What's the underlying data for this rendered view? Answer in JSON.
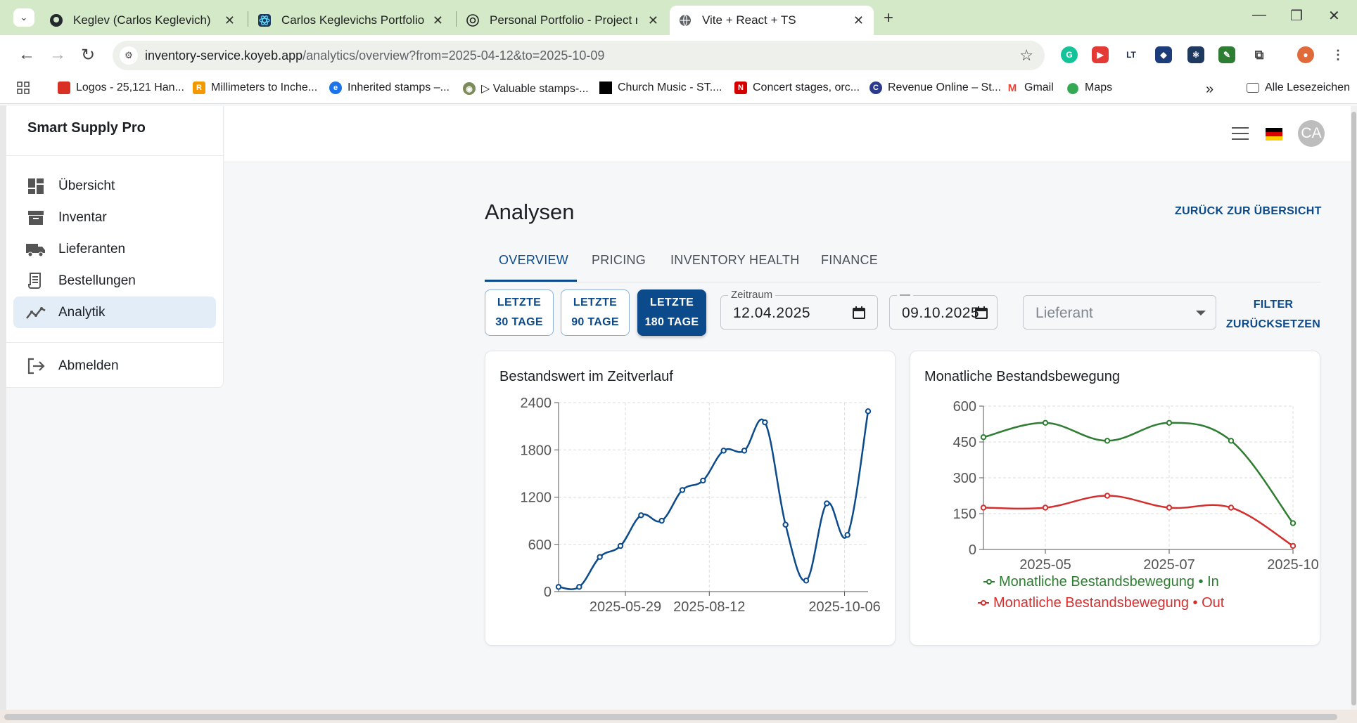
{
  "browser": {
    "tabs": [
      {
        "title": "Keglev (Carlos Keglevich)",
        "icon": "github-icon"
      },
      {
        "title": "Carlos Keglevichs Portfolio",
        "icon": "react-icon"
      },
      {
        "title": "Personal Portfolio - Project revie",
        "icon": "openai-icon"
      },
      {
        "title": "Vite + React + TS",
        "icon": "globe-icon"
      }
    ],
    "url_host": "inventory-service.koyeb.app",
    "url_path": "/analytics/overview?from=2025-04-12&to=2025-10-09",
    "bookmarks": [
      {
        "label": "Logos - 25,121 Han...",
        "color": "#d93025"
      },
      {
        "label": "Millimeters to Inche...",
        "color": "#f29900"
      },
      {
        "label": "Inherited stamps –...",
        "color": "#1a73e8"
      },
      {
        "label": "▷ Valuable stamps-...",
        "color": "#7b8b5a"
      },
      {
        "label": "Church Music - ST....",
        "color": "#000000"
      },
      {
        "label": "Concert stages, orc...",
        "color": "#d50000"
      },
      {
        "label": "Revenue Online – St...",
        "color": "#2b3a8c"
      },
      {
        "label": "Gmail",
        "color": "#ea4335"
      },
      {
        "label": "Maps",
        "color": "#34a853"
      }
    ],
    "all_bookmarks": "Alle Lesezeichen"
  },
  "sidebar": {
    "brand": "Smart Supply Pro",
    "items": [
      {
        "label": "Übersicht",
        "icon": "dashboard-icon"
      },
      {
        "label": "Inventar",
        "icon": "archive-icon"
      },
      {
        "label": "Lieferanten",
        "icon": "truck-icon"
      },
      {
        "label": "Bestellungen",
        "icon": "receipt-icon"
      },
      {
        "label": "Analytik",
        "icon": "analytics-icon"
      }
    ],
    "logout": "Abmelden"
  },
  "header": {
    "avatar_initials": "CA"
  },
  "page": {
    "title": "Analysen",
    "back_link": "ZURÜCK ZUR ÜBERSICHT",
    "tabs": [
      "OVERVIEW",
      "PRICING",
      "INVENTORY HEALTH",
      "FINANCE"
    ],
    "range_buttons": [
      {
        "line1": "LETZTE",
        "line2": "30 TAGE"
      },
      {
        "line1": "LETZTE",
        "line2": "90 TAGE"
      },
      {
        "line1": "LETZTE",
        "line2": "180 TAGE"
      }
    ],
    "date_from_label": "Zeitraum",
    "date_from": "12.04.2025",
    "date_to_label": "—",
    "date_to": "09.10.2025",
    "supplier_placeholder": "Lieferant",
    "reset_line1": "FILTER",
    "reset_line2": "ZURÜCKSETZEN"
  },
  "colors": {
    "primary": "#0b4a8b",
    "in": "#2e7d32",
    "out": "#d32f2f",
    "line": "#0b4a8b"
  },
  "chart_data": [
    {
      "type": "line",
      "title": "Bestandswert im Zeitverlauf",
      "x_ticks": [
        "2025-05-29",
        "2025-08-12",
        "2025-10-06"
      ],
      "y_ticks": [
        0,
        600,
        1200,
        1800,
        2400
      ],
      "ylim": [
        0,
        2400
      ],
      "grid": true,
      "series": [
        {
          "values": [
            60,
            60,
            440,
            580,
            970,
            900,
            1290,
            1410,
            1790,
            1790,
            2150,
            850,
            140,
            1120,
            720,
            2290
          ]
        }
      ]
    },
    {
      "type": "line",
      "title": "Monatliche Bestandsbewegung",
      "x_ticks": [
        "2025-05",
        "2025-07",
        "2025-10"
      ],
      "y_ticks": [
        0,
        150,
        300,
        450,
        600
      ],
      "ylim": [
        0,
        600
      ],
      "grid": true,
      "legend": "bottom",
      "series": [
        {
          "name": "Monatliche Bestandsbewegung • In",
          "values": [
            470,
            530,
            455,
            530,
            455,
            110
          ]
        },
        {
          "name": "Monatliche Bestandsbewegung • Out",
          "values": [
            175,
            175,
            225,
            175,
            175,
            15
          ]
        }
      ]
    }
  ]
}
